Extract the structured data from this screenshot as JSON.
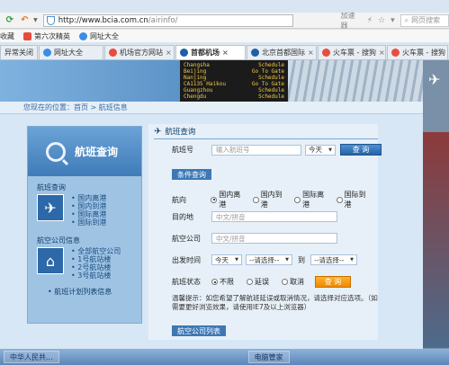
{
  "browser": {
    "url_host": "http://www.bcia.com.cn",
    "url_path": "/airinfo/",
    "accelerator_label": "加速器",
    "search_placeholder": "网页搜索"
  },
  "bookmarks": [
    {
      "label": "收藏"
    },
    {
      "label": "第六次精英"
    },
    {
      "label": "网址大全"
    }
  ],
  "tabs": [
    {
      "label": "异常关闭"
    },
    {
      "label": "网址大全"
    },
    {
      "label": "机场官方网站"
    },
    {
      "label": "首都机场",
      "active": true
    },
    {
      "label": "北京首都国际"
    },
    {
      "label": "火车票 - 搜狗"
    },
    {
      "label": "火车票 - 搜狗"
    }
  ],
  "board_rows": [
    [
      "Changsha",
      "Schedule"
    ],
    [
      "Beijing",
      "Go To Gate"
    ],
    [
      "Nanjing",
      "Schedule"
    ],
    [
      "CA1135 Haikou",
      "Go To Gate"
    ],
    [
      "Guangzhou",
      "Schedule"
    ],
    [
      "Chengdu",
      "Schedule"
    ]
  ],
  "breadcrumb": "您现在的位置：首页 > 航班信息",
  "sidebar": {
    "title": "航班查询",
    "flight_section": "航班查询",
    "flight_links": [
      "国内离港",
      "国内到港",
      "国际离港",
      "国际到港"
    ],
    "airline_section": "航空公司信息",
    "airline_links": [
      "全部航空公司",
      "1号航站楼",
      "2号航站楼",
      "3号航站楼"
    ],
    "schedule_link": "航班计划列表信息"
  },
  "main": {
    "title": "航班查询",
    "flight_no_label": "航班号",
    "flight_no_placeholder": "输入航班号",
    "day_select": "今天",
    "query_button": "查 询",
    "condition_tab": "条件查询",
    "direction_label": "航向",
    "direction_options": [
      "国内离港",
      "国内到港",
      "国际离港",
      "国际到港"
    ],
    "destination_label": "目的地",
    "destination_placeholder": "中文/拼音",
    "airline_label": "航空公司",
    "airline_placeholder": "中文/拼音",
    "departure_label": "出发时间",
    "departure_day": "今天",
    "time_from": "--请选择--",
    "to_label": "到",
    "time_to": "--请选择--",
    "status_label": "航班状态",
    "status_options": [
      "不限",
      "延误",
      "取消"
    ],
    "query_button2": "查 询",
    "tip": "温馨提示：如您希望了解航班延误或取消情况，请选择对应选项。（如需要更好浏览效果，请使用IE7及以上浏览器）",
    "schedule_tab": "航空公司列表"
  },
  "taskbar": [
    {
      "label": "中华人民共..."
    },
    {
      "label": "电脑管家"
    }
  ],
  "colors": {
    "accent": "#3d78b6",
    "orange": "#f08a00"
  }
}
